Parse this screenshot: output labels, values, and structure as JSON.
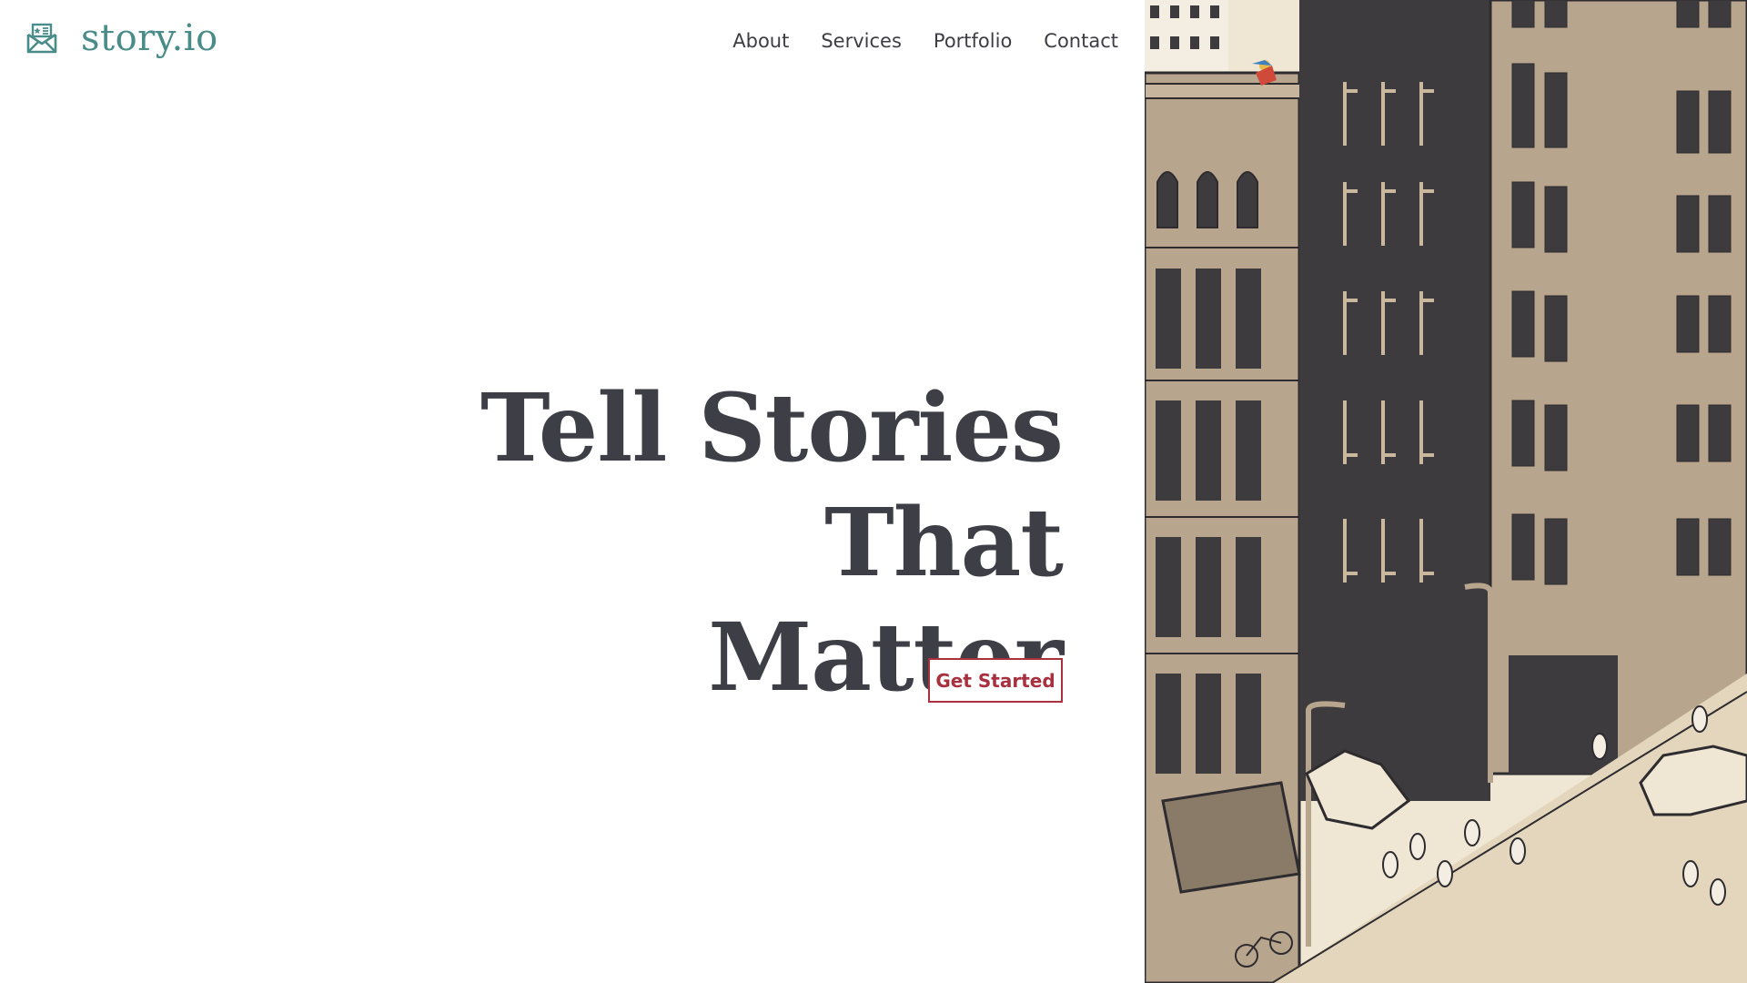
{
  "brand": {
    "name": "story.io",
    "icon": "envelope-star-icon",
    "color": "#4a8c8a"
  },
  "nav": {
    "items": [
      {
        "label": "About"
      },
      {
        "label": "Services"
      },
      {
        "label": "Portfolio"
      },
      {
        "label": "Contact"
      }
    ]
  },
  "hero": {
    "title_line_1": "Tell Stories That",
    "title_line_2": "Matter",
    "cta_label": "Get Started",
    "accent_color": "#a8303f",
    "text_color": "#3e3e46"
  },
  "illustration": {
    "subject": "city-street-illustration",
    "palette": [
      "#efe6d4",
      "#b8a58d",
      "#3d3b3e"
    ]
  }
}
